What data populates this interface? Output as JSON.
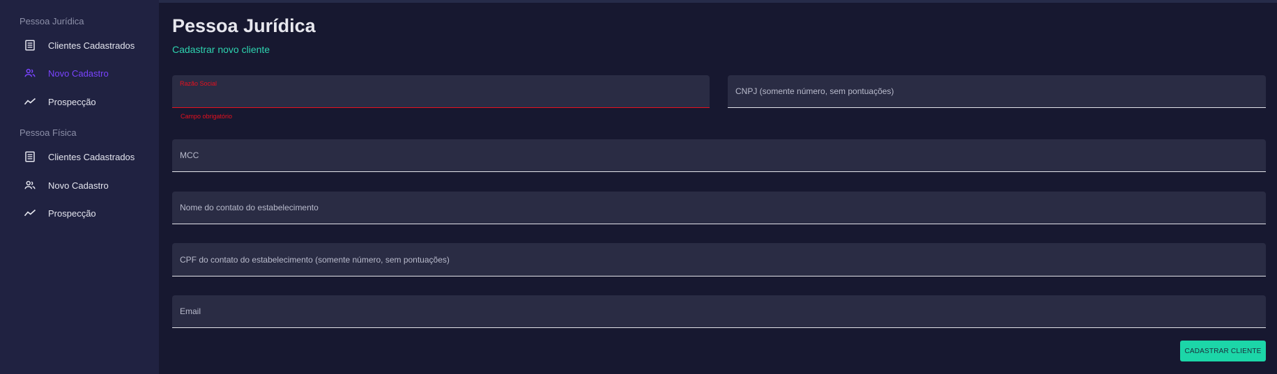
{
  "sidebar": {
    "sections": [
      {
        "title": "Pessoa Jurídica",
        "items": [
          {
            "label": "Clientes Cadastrados",
            "icon": "list-icon"
          },
          {
            "label": "Novo Cadastro",
            "icon": "people-icon",
            "active": true
          },
          {
            "label": "Prospecção",
            "icon": "trending-icon"
          }
        ]
      },
      {
        "title": "Pessoa Física",
        "items": [
          {
            "label": "Clientes Cadastrados",
            "icon": "list-icon"
          },
          {
            "label": "Novo Cadastro",
            "icon": "people-icon"
          },
          {
            "label": "Prospecção",
            "icon": "trending-icon"
          }
        ]
      }
    ]
  },
  "main": {
    "title": "Pessoa Jurídica",
    "subtitle": "Cadastrar novo cliente"
  },
  "form": {
    "razao_social": {
      "label": "Razão Social",
      "value": "",
      "error": "Campo obrigatório"
    },
    "cnpj": {
      "label": "CNPJ (somente número, sem pontuações)",
      "value": ""
    },
    "mcc": {
      "label": "MCC",
      "value": ""
    },
    "contato_nome": {
      "label": "Nome do contato do estabelecimento",
      "value": ""
    },
    "contato_cpf": {
      "label": "CPF do contato do estabelecimento (somente número, sem pontuações)",
      "value": ""
    },
    "email": {
      "label": "Email",
      "value": ""
    },
    "submit_label": "CADASTRAR CLIENTE"
  },
  "colors": {
    "sidebar_bg": "#202241",
    "main_bg": "#171830",
    "accent_teal": "#1cd6a8",
    "active_purple": "#7a44ff",
    "error_red": "#e8101e"
  }
}
